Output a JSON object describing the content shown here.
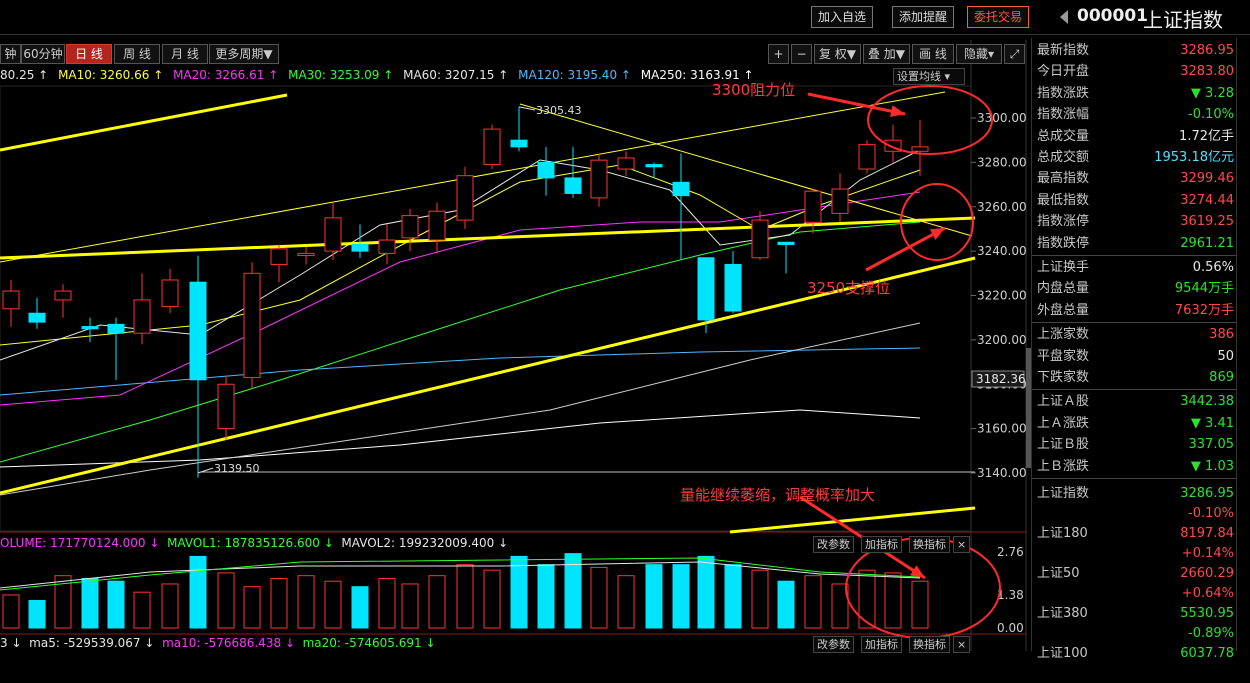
{
  "top": {
    "buttons": [
      "加入自选",
      "添加提醒",
      "委托交易"
    ],
    "code": "000001",
    "name": "上证指数"
  },
  "toolbar": {
    "periods": [
      "钟",
      "60分钟",
      "日 线",
      "周 线",
      "月 线",
      "更多周期▼"
    ],
    "tools": [
      "+",
      "−",
      "复 权▼",
      "叠 加▼",
      "画 线",
      "隐藏▾"
    ],
    "set_ma": "设置均线 ▾"
  },
  "ma_line": {
    "ma5": "80.25 ↑",
    "ma10": "MA10: 3260.66 ↑",
    "ma20": "MA20: 3266.61 ↑",
    "ma30": "MA30: 3253.09 ↑",
    "ma60": "MA60: 3207.15 ↑",
    "ma120": "MA120: 3195.40 ↑",
    "ma250": "MA250: 3163.91 ↑"
  },
  "price_axis": [
    "3300.00",
    "3280.00",
    "3260.00",
    "3240.00",
    "3220.00",
    "3200.00",
    "3180.00",
    "3160.00",
    "3140.00"
  ],
  "current_price_tag": "3182.36",
  "high_mark": "3305.43",
  "low_mark": "3139.50",
  "annotations": {
    "resistance": "3300阻力位",
    "support": "3250支撑位",
    "volume_note": "量能继续萎缩，调整概率加大"
  },
  "volume": {
    "header_volume": "OLUME: 171770124.000 ↓",
    "header_mavol1": "MAVOL1: 187835126.600 ↓",
    "header_mavol2": "MAVOL2: 199232009.400 ↓",
    "axis": [
      "2.76",
      "1.38",
      "0.00"
    ],
    "buttons": [
      "改参数",
      "加指标",
      "换指标",
      "×"
    ]
  },
  "indicator": {
    "header_a": "3 ↓",
    "header_ma5": "ma5: -529539.067 ↓",
    "header_ma10": "ma10: -576686.438 ↓",
    "header_ma20": "ma20: -574605.691 ↓",
    "buttons": [
      "改参数",
      "加指标",
      "换指标",
      "×"
    ]
  },
  "panel": {
    "rows1": [
      {
        "label": "最新指数",
        "value": "3286.95",
        "color": "red"
      },
      {
        "label": "今日开盘",
        "value": "3283.80",
        "color": "red"
      },
      {
        "label": "指数涨跌",
        "value": "▼ 3.28",
        "color": "green"
      },
      {
        "label": "指数涨幅",
        "value": "-0.10%",
        "color": "green"
      },
      {
        "label": "总成交量",
        "value": "1.72亿手",
        "color": "white"
      },
      {
        "label": "总成交额",
        "value": "1953.18亿元",
        "color": "cyan"
      },
      {
        "label": "最高指数",
        "value": "3299.46",
        "color": "red"
      },
      {
        "label": "最低指数",
        "value": "3274.44",
        "color": "red"
      },
      {
        "label": "指数涨停",
        "value": "3619.25",
        "color": "red"
      },
      {
        "label": "指数跌停",
        "value": "2961.21",
        "color": "green"
      }
    ],
    "rows2": [
      {
        "label": "上证换手",
        "value": "0.56%",
        "color": "white"
      },
      {
        "label": "内盘总量",
        "value": "9544万手",
        "color": "green"
      },
      {
        "label": "外盘总量",
        "value": "7632万手",
        "color": "red"
      }
    ],
    "rows3": [
      {
        "label": "上涨家数",
        "value": "386",
        "color": "red"
      },
      {
        "label": "平盘家数",
        "value": "50",
        "color": "white"
      },
      {
        "label": "下跌家数",
        "value": "869",
        "color": "green"
      }
    ],
    "rows4": [
      {
        "label": "上证Ａ股",
        "value": "3442.38",
        "color": "green"
      },
      {
        "label": "上Ａ涨跌",
        "value": "▼ 3.41",
        "color": "green"
      },
      {
        "label": "上证Ｂ股",
        "value": "337.05",
        "color": "green"
      },
      {
        "label": "上Ｂ涨跌",
        "value": "▼ 1.03",
        "color": "green"
      }
    ],
    "indices": [
      {
        "label": "上证指数",
        "value": "3286.95",
        "pct": "-0.10%",
        "vcolor": "green",
        "pcolor": "red"
      },
      {
        "label": "上证180",
        "value": "8197.84",
        "pct": "+0.14%",
        "vcolor": "red",
        "pcolor": "red"
      },
      {
        "label": "上证50",
        "value": "2660.29",
        "pct": "+0.64%",
        "vcolor": "red",
        "pcolor": "red"
      },
      {
        "label": "上证380",
        "value": "5530.95",
        "pct": "-0.89%",
        "vcolor": "green",
        "pcolor": "green"
      },
      {
        "label": "上证100",
        "value": "6037.78",
        "pct": "",
        "vcolor": "green",
        "pcolor": "green"
      }
    ]
  }
}
